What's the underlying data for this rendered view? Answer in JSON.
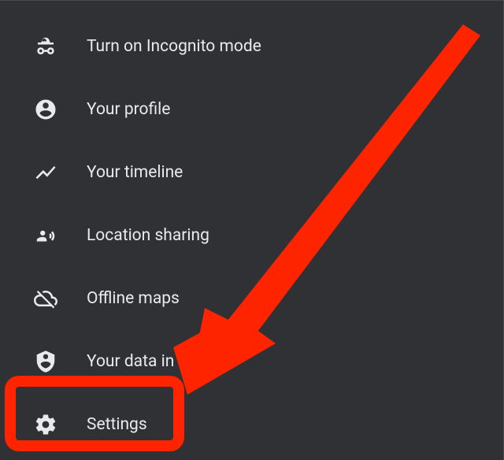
{
  "menu": {
    "items": [
      {
        "label": "Turn on Incognito mode"
      },
      {
        "label": "Your profile"
      },
      {
        "label": "Your timeline"
      },
      {
        "label": "Location sharing"
      },
      {
        "label": "Offline maps"
      },
      {
        "label": "Your data in Maps"
      },
      {
        "label": "Settings"
      }
    ]
  },
  "annotation": {
    "arrow_color": "#ff2400",
    "highlight_color": "#ff2400",
    "highlighted_item": "Settings"
  }
}
